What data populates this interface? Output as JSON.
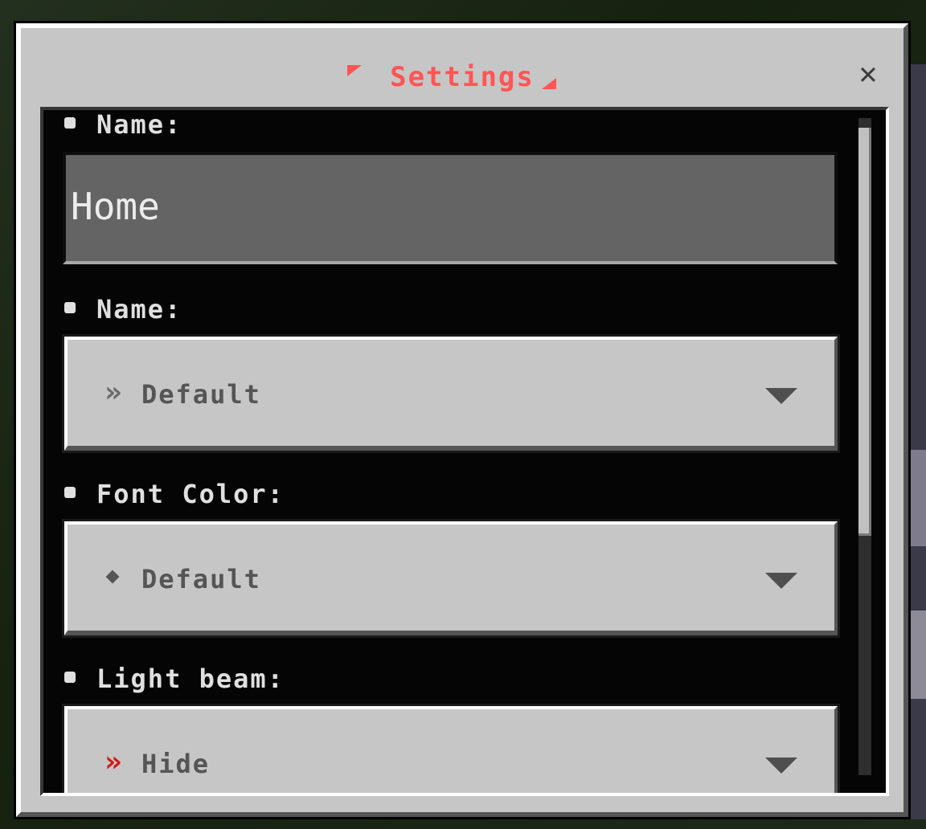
{
  "window": {
    "title": "Settings",
    "close_glyph": "✕"
  },
  "fields": [
    {
      "label": "Name:",
      "kind": "text",
      "value": "Home"
    },
    {
      "label": "Name:",
      "kind": "dropdown",
      "value": "Default",
      "icon": "double-chevron-right-icon",
      "icon_glyph": "»",
      "icon_color": "#6a6a6a"
    },
    {
      "label": "Font Color:",
      "kind": "dropdown",
      "value": "Default",
      "icon": "diamond-icon",
      "icon_color": "#555555"
    },
    {
      "label": "Light beam:",
      "kind": "dropdown",
      "value": "Hide",
      "icon": "double-chevron-right-icon",
      "icon_glyph": "»",
      "icon_color": "#d11a1a"
    }
  ],
  "colors": {
    "title": "#ff5555",
    "window_bg": "#c6c6c6",
    "panel_bg": "#050505",
    "input_bg": "#646464"
  },
  "scrollbar": {
    "position": 0
  }
}
